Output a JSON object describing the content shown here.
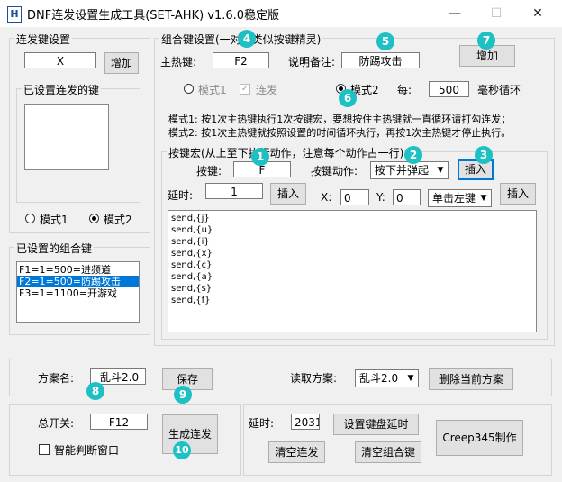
{
  "window": {
    "title": "DNF连发设置生成工具(SET-AHK) v1.6.0稳定版",
    "app_icon": "H",
    "min_glyph": "—",
    "max_glyph": "☐",
    "close_glyph": "✕"
  },
  "repeat_group": {
    "label": "连发键设置",
    "key_value": "X",
    "add_button": "增加",
    "set_keys_label": "已设置连发的键",
    "mode1_label": "模式1",
    "mode2_label": "模式2"
  },
  "combo_list_group": {
    "label": "已设置的组合键",
    "items": [
      "F1=1=500=进频道",
      "F2=1=500=防踢攻击",
      "F3=1=1100=开游戏"
    ]
  },
  "combo_group": {
    "label": "组合键设置(一对多类似按键精灵)",
    "hotkey_label": "主热键:",
    "hotkey_value": "F2",
    "note_label": "说明备注:",
    "note_value": "防踢攻击",
    "add_button": "增加",
    "mode1_label": "模式1",
    "repeat_label": "连发",
    "mode2_label": "模式2",
    "every_label": "每:",
    "ms_value": "500",
    "ms_label": "毫秒循环",
    "desc_line1": "模式1: 按1次主热键执行1次按键宏，要想按住主热键就一直循环请打勾连发；",
    "desc_line2": "模式2: 按1次主热键就按照设置的时间循环执行，再按1次主热键才停止执行。"
  },
  "macro_group": {
    "label": "按键宏(从上至下执行动作，注意每个动作占一行)",
    "key_label": "按键:",
    "key_value": "F",
    "action_label": "按键动作:",
    "action_value": "按下并弹起",
    "insert_button": "插入",
    "delay_label": "延时:",
    "delay_value": "1",
    "insert_delay_button": "插入",
    "x_label": "X:",
    "x_value": "0",
    "y_label": "Y:",
    "y_value": "0",
    "click_value": "单击左键",
    "insert_click_button": "插入",
    "lines": [
      "send,{j}",
      "send,{u}",
      "send,{i}",
      "send,{x}",
      "send,{c}",
      "send,{a}",
      "send,{s}",
      "send,{f}"
    ]
  },
  "scheme": {
    "name_label": "方案名:",
    "name_value": "乱斗2.0",
    "save_button": "保存",
    "read_label": "读取方案:",
    "read_value": "乱斗2.0",
    "delete_button": "删除当前方案"
  },
  "bottom_left": {
    "switch_label": "总开关:",
    "switch_value": "F12",
    "smart_window_label": "智能判断窗口",
    "generate_button": "生成连发"
  },
  "bottom_right": {
    "delay_label": "延时:",
    "delay_value": "2031",
    "set_delay_button": "设置键盘延时",
    "clear_repeat_button": "清空连发",
    "clear_combo_button": "清空组合键",
    "credit_button": "Creep345制作"
  },
  "badges": [
    "1",
    "2",
    "3",
    "4",
    "5",
    "6",
    "7",
    "8",
    "9",
    "10"
  ],
  "colors": {
    "badge": "#1ec0c3",
    "selection": "#0078d7",
    "window_bg": "#f0f0f0"
  }
}
